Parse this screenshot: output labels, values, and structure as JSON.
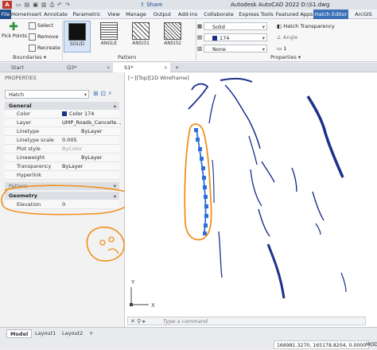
{
  "titlebar": {
    "app_letter": "A",
    "share": "Share",
    "title": "Autodesk AutoCAD 2022    D:\\S1.dwg"
  },
  "ribbon_tabs": [
    "File",
    "Home",
    "Insert",
    "Annotate",
    "Parametric",
    "View",
    "Manage",
    "Output",
    "Add-ins",
    "Collaborate",
    "Express Tools",
    "Featured Apps",
    "Hatch Editor",
    "ArcGIS"
  ],
  "ribbon": {
    "pick_points": "Pick Points",
    "select": "Select",
    "remove": "Remove",
    "recreate": "Recreate",
    "boundaries_label": "Boundaries",
    "pattern_label": "Pattern",
    "properties_label": "Properties",
    "patterns": [
      {
        "name": "SOLID"
      },
      {
        "name": "ANGLE"
      },
      {
        "name": "ANSI31"
      },
      {
        "name": "ANSI32"
      }
    ],
    "hatch_type": "Solid",
    "hatch_color": "174",
    "hatch_color_hex": "#1c2f8a",
    "background_color": "None",
    "hatch_transparency_label": "Hatch Transparency",
    "angle_label": "Angle",
    "scale_value": "1"
  },
  "doc_tabs": [
    "Start",
    "Q3*",
    "S1*"
  ],
  "palette": {
    "title": "PROPERTIES",
    "object_type": "Hatch",
    "general_header": "General",
    "general_rows": [
      {
        "key": "Color",
        "value": "Color 174"
      },
      {
        "key": "Layer",
        "value": "UMP_Roads_Cancelle..."
      },
      {
        "key": "Linetype",
        "value": "ByLayer"
      },
      {
        "key": "Linetype scale",
        "value": "0.005"
      },
      {
        "key": "Plot style",
        "value": "ByColor"
      },
      {
        "key": "Lineweight",
        "value": "ByLayer"
      },
      {
        "key": "Transparency",
        "value": "ByLayer"
      },
      {
        "key": "Hyperlink",
        "value": ""
      }
    ],
    "pattern_header": "Pattern",
    "geometry_header": "Geometry",
    "geometry_rows": [
      {
        "key": "Elevation",
        "value": "0"
      }
    ]
  },
  "canvas": {
    "viewport_label": "[−][Top][2D Wireframe]",
    "ucs_y": "Y",
    "ucs_x": "X"
  },
  "command": {
    "placeholder": "Type a command"
  },
  "status": {
    "layout_tabs": [
      "Model",
      "Layout1",
      "Layout2"
    ],
    "add_layout": "+",
    "coords": "166981.3270, 165178.8204, 0.0000",
    "mode": "MOD"
  },
  "colors": {
    "drawing_lines": "#1c2f8a",
    "selection_grips": "#2c6fd8",
    "annotation": "#f0901e",
    "accent_tab": "#3b6fb6"
  }
}
